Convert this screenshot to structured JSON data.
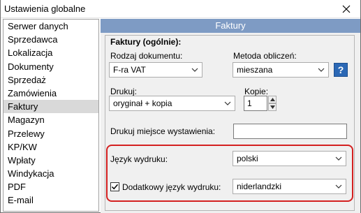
{
  "window": {
    "title": "Ustawienia globalne"
  },
  "sidebar": {
    "items": [
      {
        "label": "Serwer danych"
      },
      {
        "label": "Sprzedawca"
      },
      {
        "label": "Lokalizacja"
      },
      {
        "label": "Dokumenty"
      },
      {
        "label": "Sprzedaż"
      },
      {
        "label": "Zamówienia"
      },
      {
        "label": "Faktury",
        "selected": true
      },
      {
        "label": "Magazyn"
      },
      {
        "label": "Przelewy"
      },
      {
        "label": "KP/KW"
      },
      {
        "label": "Wpłaty"
      },
      {
        "label": "Windykacja"
      },
      {
        "label": "PDF"
      },
      {
        "label": "E-mail"
      }
    ]
  },
  "section": {
    "header": "Faktury",
    "group_title": "Faktury (ogólnie):"
  },
  "form": {
    "doc_type_label": "Rodzaj dokumentu:",
    "doc_type_value": "F-ra VAT",
    "calc_method_label": "Metoda obliczeń:",
    "calc_method_value": "mieszana",
    "help_label": "?",
    "print_label": "Drukuj:",
    "print_value": "oryginał + kopia",
    "copies_label": "Kopie:",
    "copies_value": "1",
    "print_place_label": "Drukuj miejsce wystawienia:",
    "print_place_value": "",
    "print_lang_label": "Język wydruku:",
    "print_lang_value": "polski",
    "extra_lang_label": "Dodatkowy język wydruku:",
    "extra_lang_value": "niderlandzki",
    "extra_lang_checked": true
  },
  "colors": {
    "header_bg": "#7e9bc4",
    "highlight": "#d42020",
    "help_bg": "#2b68b5"
  }
}
